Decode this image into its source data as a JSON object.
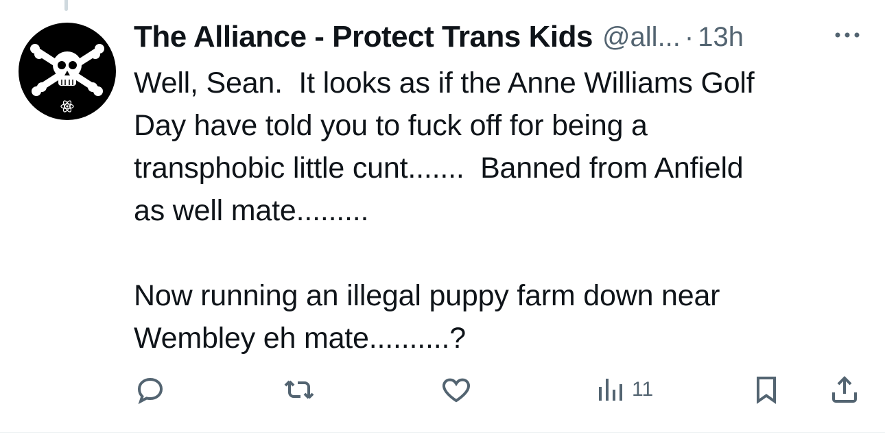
{
  "tweet": {
    "author_name": "The Alliance - Protect Trans Kids",
    "handle": "@all...",
    "separator": "·",
    "time": "13h",
    "text": "Well, Sean.  It looks as if the Anne Williams Golf\nDay have told you to fuck off for being a\ntransphobic little cunt.......  Banned from Anfield\nas well mate.........\n\nNow running an illegal puppy farm down near\nWembley eh mate..........?"
  },
  "actions": {
    "reply_icon": "reply-icon",
    "retweet_icon": "retweet-icon",
    "like_icon": "heart-icon",
    "views_icon": "bar-chart-icon",
    "views_count": "11",
    "bookmark_icon": "bookmark-icon",
    "share_icon": "share-icon"
  },
  "colors": {
    "text_primary": "#0f1419",
    "text_secondary": "#536471",
    "avatar_bg": "#000000"
  }
}
